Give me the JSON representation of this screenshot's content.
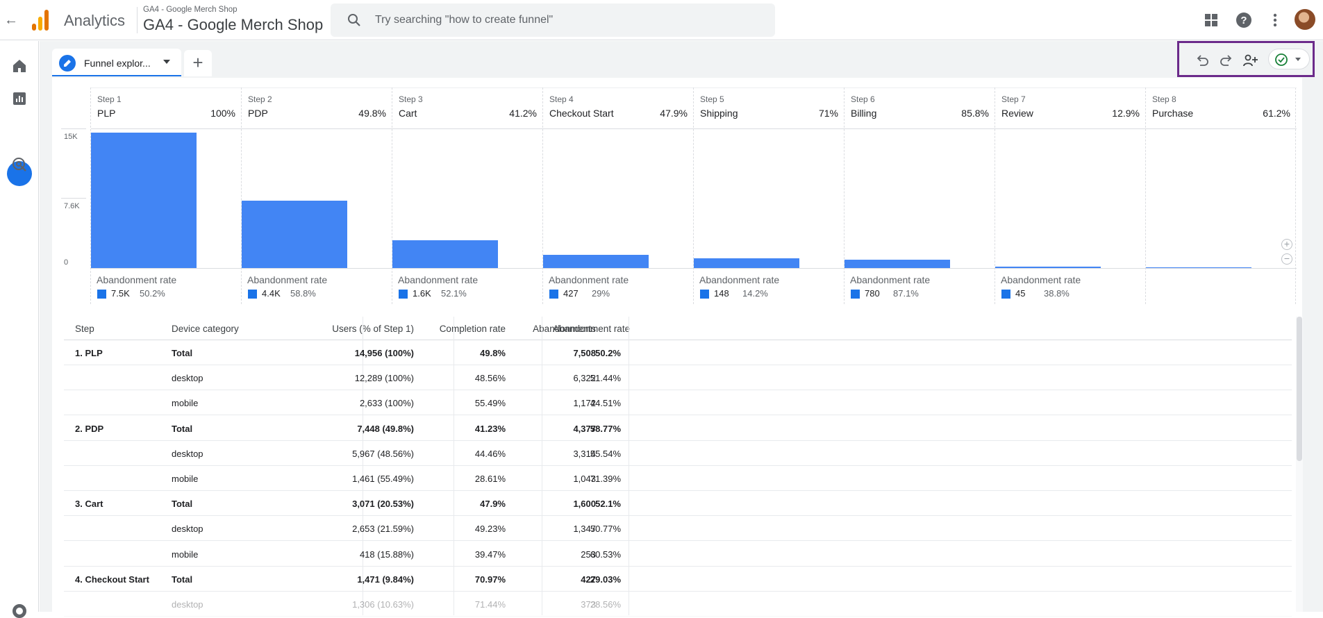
{
  "header": {
    "app_name": "Analytics",
    "property_sub": "GA4 - Google Merch Shop",
    "property_main": "GA4 - Google Merch Shop",
    "search_placeholder": "Try searching \"how to create funnel\""
  },
  "tabs": [
    {
      "label": "Funnel explor..."
    }
  ],
  "chart_data": {
    "type": "bar",
    "y_ticks": [
      "15K",
      "7.6K",
      "0"
    ],
    "ylim": [
      0,
      15000
    ],
    "steps": [
      {
        "num": "Step 1",
        "name": "PLP",
        "pct": "100%",
        "value": 14956,
        "ab_count": "7.5K",
        "ab_rate": "50.2%"
      },
      {
        "num": "Step 2",
        "name": "PDP",
        "pct": "49.8%",
        "value": 7448,
        "ab_count": "4.4K",
        "ab_rate": "58.8%"
      },
      {
        "num": "Step 3",
        "name": "Cart",
        "pct": "41.2%",
        "value": 3071,
        "ab_count": "1.6K",
        "ab_rate": "52.1%"
      },
      {
        "num": "Step 4",
        "name": "Checkout Start",
        "pct": "47.9%",
        "value": 1471,
        "ab_count": "427",
        "ab_rate": "29%"
      },
      {
        "num": "Step 5",
        "name": "Shipping",
        "pct": "71%",
        "value": 1044,
        "ab_count": "148",
        "ab_rate": "14.2%"
      },
      {
        "num": "Step 6",
        "name": "Billing",
        "pct": "85.8%",
        "value": 896,
        "ab_count": "780",
        "ab_rate": "87.1%"
      },
      {
        "num": "Step 7",
        "name": "Review",
        "pct": "12.9%",
        "value": 116,
        "ab_count": "45",
        "ab_rate": "38.8%"
      },
      {
        "num": "Step 8",
        "name": "Purchase",
        "pct": "61.2%",
        "value": 71,
        "ab_count": "",
        "ab_rate": ""
      }
    ],
    "footer_label": "Abandonment rate"
  },
  "table": {
    "headers": [
      "Step",
      "Device category",
      "Users (% of Step 1)",
      "Completion rate",
      "Abandonments",
      "Abandonment rate"
    ],
    "rows": [
      {
        "step": "1. PLP",
        "device": "Total",
        "users": "14,956 (100%)",
        "completion": "49.8%",
        "abandonments": "7,508",
        "ab_rate": "50.2%",
        "bold": true
      },
      {
        "step": "",
        "device": "desktop",
        "users": "12,289 (100%)",
        "completion": "48.56%",
        "abandonments": "6,322",
        "ab_rate": "51.44%",
        "bold": false
      },
      {
        "step": "",
        "device": "mobile",
        "users": "2,633 (100%)",
        "completion": "55.49%",
        "abandonments": "1,172",
        "ab_rate": "44.51%",
        "bold": false
      },
      {
        "step": "2. PDP",
        "device": "Total",
        "users": "7,448 (49.8%)",
        "completion": "41.23%",
        "abandonments": "4,377",
        "ab_rate": "58.77%",
        "bold": true
      },
      {
        "step": "",
        "device": "desktop",
        "users": "5,967 (48.56%)",
        "completion": "44.46%",
        "abandonments": "3,314",
        "ab_rate": "55.54%",
        "bold": false
      },
      {
        "step": "",
        "device": "mobile",
        "users": "1,461 (55.49%)",
        "completion": "28.61%",
        "abandonments": "1,043",
        "ab_rate": "71.39%",
        "bold": false
      },
      {
        "step": "3. Cart",
        "device": "Total",
        "users": "3,071 (20.53%)",
        "completion": "47.9%",
        "abandonments": "1,600",
        "ab_rate": "52.1%",
        "bold": true
      },
      {
        "step": "",
        "device": "desktop",
        "users": "2,653 (21.59%)",
        "completion": "49.23%",
        "abandonments": "1,347",
        "ab_rate": "50.77%",
        "bold": false
      },
      {
        "step": "",
        "device": "mobile",
        "users": "418 (15.88%)",
        "completion": "39.47%",
        "abandonments": "253",
        "ab_rate": "60.53%",
        "bold": false
      },
      {
        "step": "4. Checkout Start",
        "device": "Total",
        "users": "1,471 (9.84%)",
        "completion": "70.97%",
        "abandonments": "427",
        "ab_rate": "29.03%",
        "bold": true
      },
      {
        "step": "",
        "device": "desktop",
        "users": "1,306 (10.63%)",
        "completion": "71.44%",
        "abandonments": "373",
        "ab_rate": "28.56%",
        "bold": false
      }
    ]
  },
  "colors": {
    "bar": "#4285f4",
    "accent": "#1a73e8",
    "highlight_box": "#6b2a8a"
  },
  "icons": {
    "toolbar": [
      "undo-icon",
      "redo-icon",
      "share-users-icon",
      "check-circle-icon"
    ],
    "topbar": [
      "apps-grid-icon",
      "help-icon",
      "more-vert-icon"
    ],
    "nav": [
      "home-icon",
      "reports-icon",
      "explore-icon",
      "advertising-icon"
    ]
  }
}
